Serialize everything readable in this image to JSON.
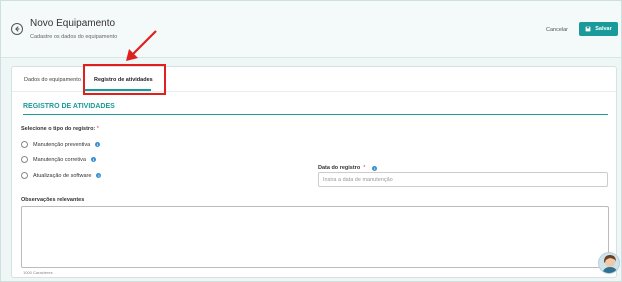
{
  "header": {
    "title": "Novo Equipamento",
    "subtitle": "Cadastre os dados do equipamento",
    "cancel_label": "Cancelar",
    "save_label": "Salvar"
  },
  "tabs": [
    {
      "label": "Dados do equipamento",
      "active": false
    },
    {
      "label": "Registro de atividades",
      "active": true
    }
  ],
  "section": {
    "title": "REGISTRO DE ATIVIDADES"
  },
  "registro": {
    "label": "Selecione o tipo do registro:",
    "required_mark": "*",
    "options": [
      "Manutenção preventiva",
      "Manutenção corretiva",
      "Atualização de software"
    ]
  },
  "data_registro": {
    "label": "Data do registro",
    "required_mark": "*",
    "placeholder": "Insira a data de manutenção"
  },
  "observacoes": {
    "label": "Observações relevantes",
    "counter": "1000 Caracteres"
  },
  "colors": {
    "accent": "#1a9a9a",
    "annotation": "#e0201e",
    "info": "#3a8fd0"
  }
}
